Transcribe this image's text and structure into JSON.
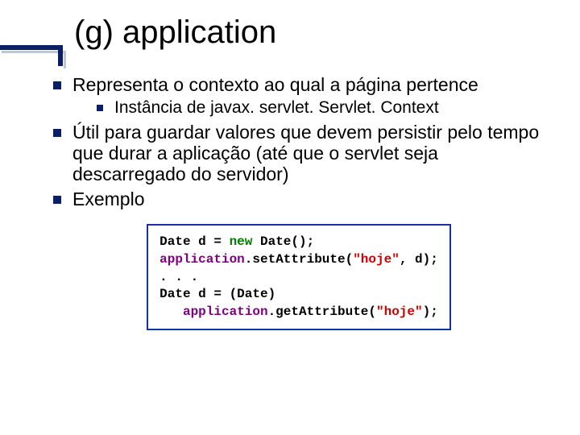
{
  "title": "(g) application",
  "bullets": {
    "b1": "Representa o contexto ao qual a página pertence",
    "b1_sub": "Instância de javax. servlet. Servlet. Context",
    "b2": "Útil para guardar valores que devem persistir pelo tempo que durar a aplicação (até que o servlet seja descarregado do servidor)",
    "b3": "Exemplo"
  },
  "code": {
    "l1a": "Date d = ",
    "l1b": "new",
    "l1c": " Date();",
    "l2a": "application",
    "l2b": ".setAttribute(",
    "l2c": "\"hoje\"",
    "l2d": ", d);",
    "l3": ". . .",
    "l4": "Date d = (Date)",
    "l5a": "   application",
    "l5b": ".getAttribute(",
    "l5c": "\"hoje\"",
    "l5d": ");"
  }
}
